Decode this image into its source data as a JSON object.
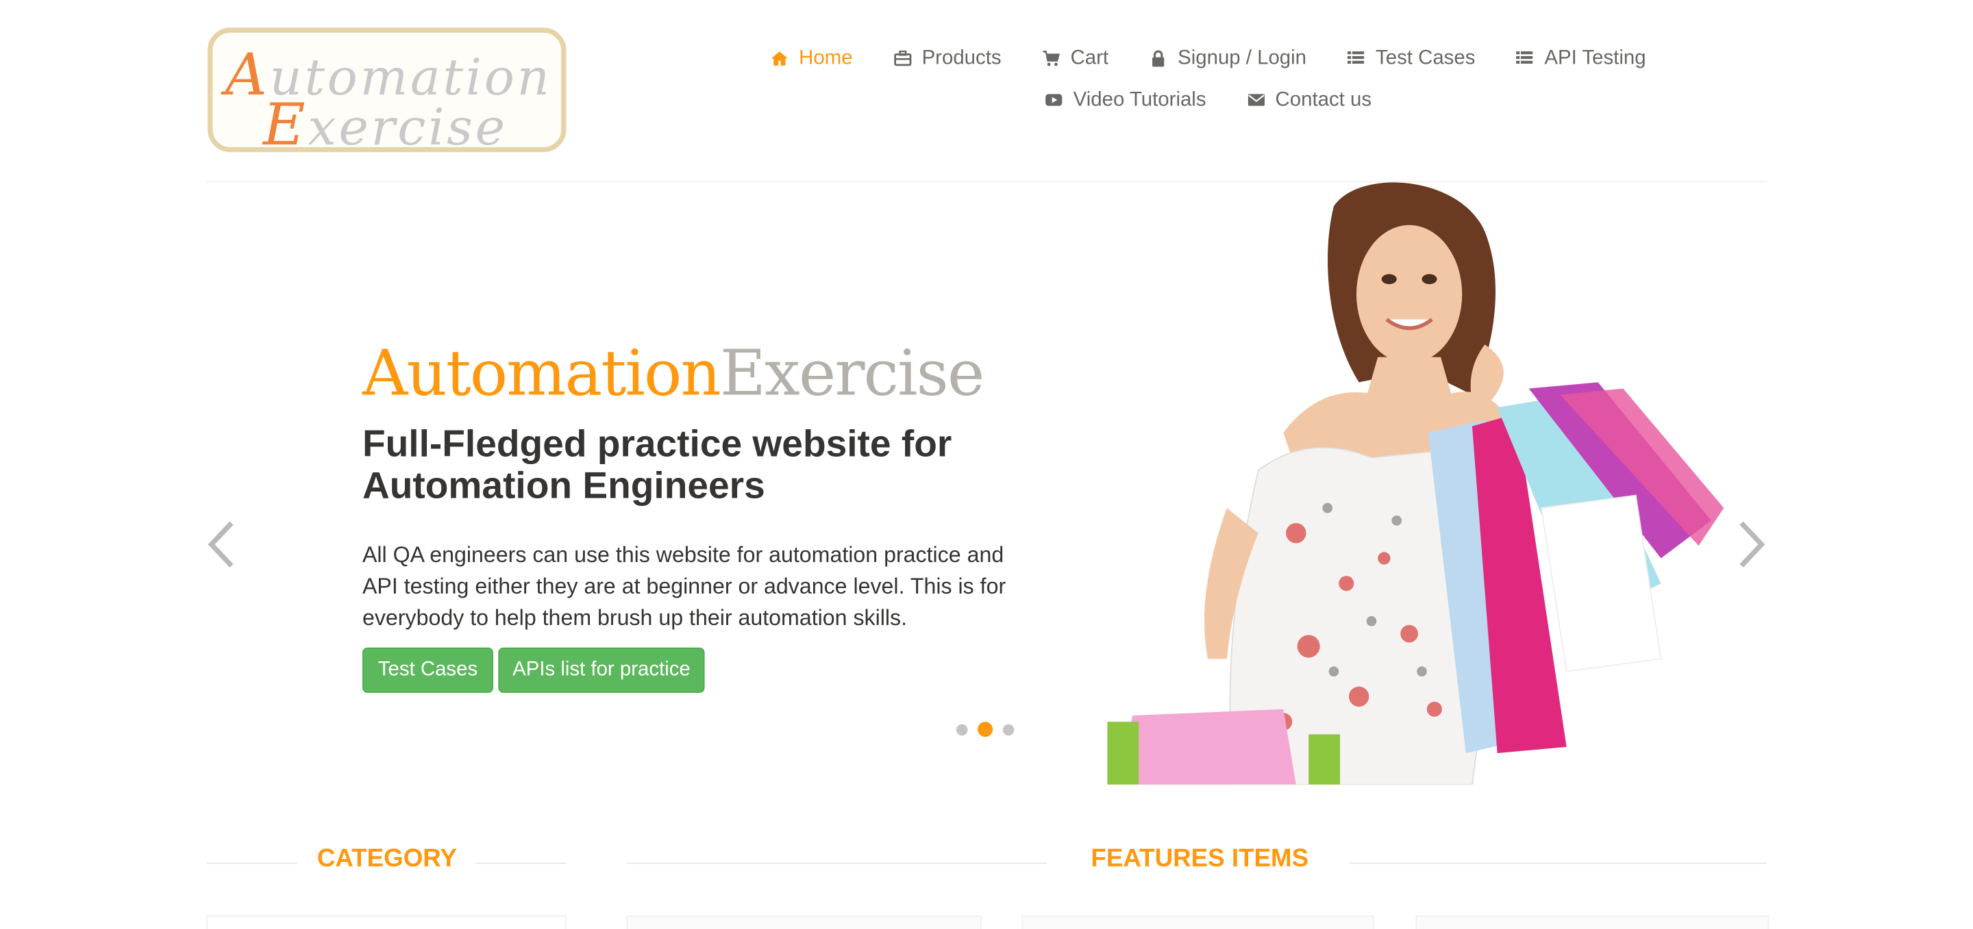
{
  "logo": {
    "line1_cap": "A",
    "line1_rest": "utomation",
    "line2_cap": "E",
    "line2_rest": "xercise"
  },
  "nav": {
    "row1": [
      {
        "label": "Home",
        "icon": "home-icon",
        "active": true
      },
      {
        "label": "Products",
        "icon": "briefcase-icon"
      },
      {
        "label": "Cart",
        "icon": "cart-icon"
      },
      {
        "label": "Signup / Login",
        "icon": "lock-icon"
      },
      {
        "label": "Test Cases",
        "icon": "list-icon"
      },
      {
        "label": "API Testing",
        "icon": "list-icon"
      }
    ],
    "row2": [
      {
        "label": "Video Tutorials",
        "icon": "youtube-play-icon"
      },
      {
        "label": "Contact us",
        "icon": "envelope-icon"
      }
    ]
  },
  "slider": {
    "brand_part1": "Automation",
    "brand_part2": "Exercise",
    "headline": "Full-Fledged practice website for Automation Engineers",
    "description": "All QA engineers can use this website for automation practice and API testing either they are at beginner or advance level. This is for everybody to help them brush up their automation skills.",
    "button_test_cases": "Test Cases",
    "button_apis": "APIs list for practice",
    "active_slide_index": 1,
    "slide_count": 3
  },
  "sections": {
    "category_title": "CATEGORY",
    "features_title": "FEATURES ITEMS"
  },
  "colors": {
    "accent": "#FE980F",
    "button_green": "#5cb85c",
    "text": "#696763",
    "heading": "#363432"
  }
}
